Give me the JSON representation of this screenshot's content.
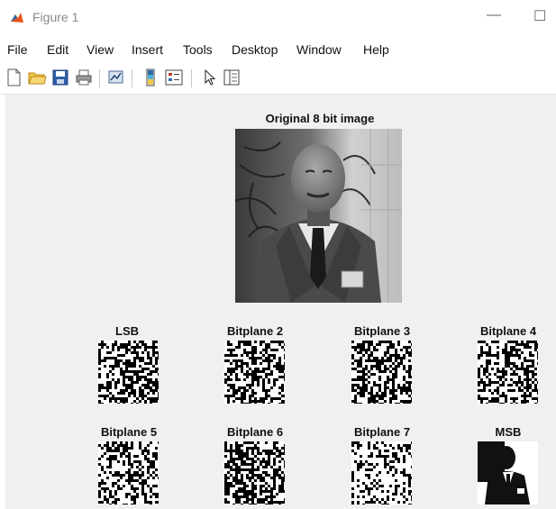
{
  "window": {
    "title": "Figure 1",
    "minimize_glyph": "—",
    "maximize_glyph": "☐"
  },
  "menu": {
    "items": [
      "File",
      "Edit",
      "View",
      "Insert",
      "Tools",
      "Desktop",
      "Window",
      "Help"
    ]
  },
  "toolbar": {
    "icons": [
      "new-figure-icon",
      "open-file-icon",
      "save-icon",
      "print-icon",
      "link-plot-icon",
      "insert-colorbar-icon",
      "insert-legend-icon",
      "edit-plot-icon",
      "property-inspector-icon"
    ]
  },
  "figure": {
    "main_title": "Original 8 bit image",
    "bitplane_titles": [
      "LSB",
      "Bitplane 2",
      "Bitplane 3",
      "Bitplane 4",
      "Bitplane 5",
      "Bitplane 6",
      "Bitplane 7",
      "MSB"
    ],
    "colors": {
      "figure_background": "#f0f0f0",
      "matlab_icon": "#e5531a"
    }
  }
}
